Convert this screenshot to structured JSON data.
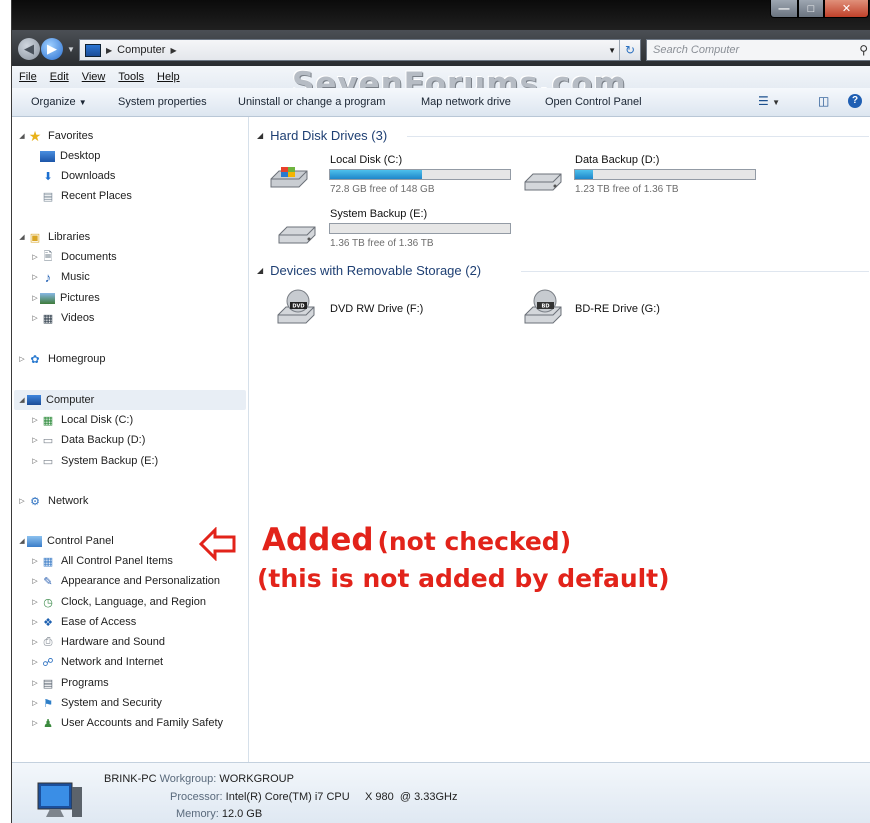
{
  "address": {
    "crumb": "Computer",
    "search_placeholder": "Search Computer"
  },
  "menu": [
    "File",
    "Edit",
    "View",
    "Tools",
    "Help"
  ],
  "watermark": "SevenForums.com",
  "commands": {
    "organize": "Organize",
    "system_properties": "System properties",
    "uninstall": "Uninstall or change a program",
    "map_drive": "Map network drive",
    "open_control_panel": "Open Control Panel"
  },
  "nav": {
    "favorites": {
      "label": "Favorites",
      "items": [
        "Desktop",
        "Downloads",
        "Recent Places"
      ]
    },
    "libraries": {
      "label": "Libraries",
      "items": [
        "Documents",
        "Music",
        "Pictures",
        "Videos"
      ]
    },
    "homegroup": "Homegroup",
    "computer": {
      "label": "Computer",
      "items": [
        "Local Disk (C:)",
        "Data Backup (D:)",
        "System Backup (E:)"
      ]
    },
    "network": "Network",
    "control_panel": {
      "label": "Control Panel",
      "items": [
        "All Control Panel Items",
        "Appearance and Personalization",
        "Clock, Language, and Region",
        "Ease of Access",
        "Hardware and Sound",
        "Network and Internet",
        "Programs",
        "System and Security",
        "User Accounts and Family Safety"
      ]
    }
  },
  "content": {
    "hdd_header": "Hard Disk Drives (3)",
    "removable_header": "Devices with Removable Storage (2)",
    "drives": [
      {
        "name": "Local Disk (C:)",
        "free": "72.8 GB free of 148 GB",
        "used_fraction": 0.51
      },
      {
        "name": "Data Backup (D:)",
        "free": "1.23 TB free of 1.36 TB",
        "used_fraction": 0.1
      },
      {
        "name": "System Backup (E:)",
        "free": "1.36 TB free of 1.36 TB",
        "used_fraction": 0.0
      }
    ],
    "removable": [
      {
        "name": "DVD RW Drive (F:)",
        "badge": "DVD"
      },
      {
        "name": "BD-RE Drive (G:)",
        "badge": "BD"
      }
    ]
  },
  "annotation": {
    "added": "Added",
    "not_checked": "(not checked)",
    "line2": "(this is not added by default)"
  },
  "details": {
    "pc_name": "BRINK-PC",
    "workgroup_label": "Workgroup:",
    "workgroup": "WORKGROUP",
    "processor_label": "Processor:",
    "processor": "Intel(R) Core(TM) i7 CPU     X 980  @ 3.33GHz",
    "memory_label": "Memory:",
    "memory": "12.0 GB"
  }
}
